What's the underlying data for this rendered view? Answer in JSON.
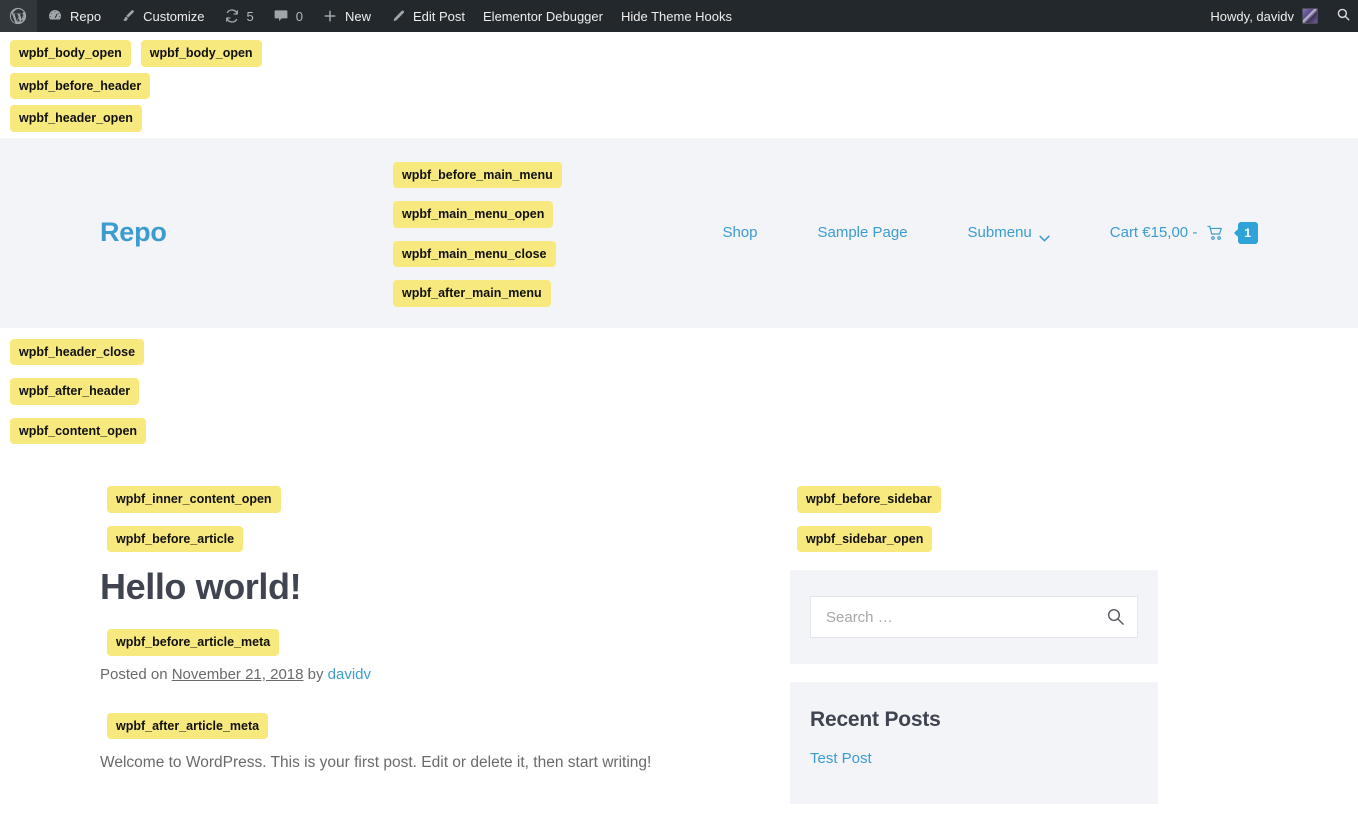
{
  "adminbar": {
    "logo_icon": "wordpress-logo-icon",
    "items": [
      {
        "icon": "dashboard-icon",
        "label": "Repo"
      },
      {
        "icon": "brush-icon",
        "label": "Customize"
      },
      {
        "icon": "refresh-icon",
        "label": "5"
      },
      {
        "icon": "comment-icon",
        "label": "0"
      },
      {
        "icon": "plus-icon",
        "label": "New"
      },
      {
        "icon": "pencil-icon",
        "label": "Edit Post"
      },
      {
        "icon": "",
        "label": "Elementor Debugger"
      },
      {
        "icon": "",
        "label": "Hide Theme Hooks"
      }
    ],
    "howdy": "Howdy, davidv",
    "avatar_name": "user-avatar",
    "search_icon": "search-icon"
  },
  "hooks": {
    "body_open_1": "wpbf_body_open",
    "body_open_2": "wpbf_body_open",
    "before_header": "wpbf_before_header",
    "header_open": "wpbf_header_open",
    "before_main_menu": "wpbf_before_main_menu",
    "main_menu_open": "wpbf_main_menu_open",
    "main_menu_close": "wpbf_main_menu_close",
    "after_main_menu": "wpbf_after_main_menu",
    "header_close": "wpbf_header_close",
    "after_header": "wpbf_after_header",
    "content_open": "wpbf_content_open",
    "inner_content_open": "wpbf_inner_content_open",
    "before_article": "wpbf_before_article",
    "before_article_meta": "wpbf_before_article_meta",
    "after_article_meta": "wpbf_after_article_meta",
    "before_sidebar": "wpbf_before_sidebar",
    "sidebar_open": "wpbf_sidebar_open"
  },
  "header": {
    "logo": "Repo",
    "nav": [
      {
        "label": "Shop",
        "has_chevron": false
      },
      {
        "label": "Sample Page",
        "has_chevron": false
      },
      {
        "label": "Submenu",
        "has_chevron": true
      }
    ],
    "cart": {
      "label": "Cart €15,00 -",
      "icon": "cart-icon",
      "count": "1"
    }
  },
  "post": {
    "title": "Hello world!",
    "meta_prefix": "Posted on ",
    "date": "November 21, 2018",
    "meta_by": " by ",
    "author": "davidv",
    "body": "Welcome to WordPress. This is your first post. Edit or delete it, then start writing!"
  },
  "sidebar": {
    "search": {
      "placeholder": "Search …",
      "value": "",
      "submit_icon": "search-icon"
    },
    "recent_posts": {
      "title": "Recent Posts",
      "items": [
        {
          "label": "Test Post"
        }
      ]
    }
  },
  "colors": {
    "admin_bar_bg": "#23282d",
    "hook_badge_bg": "#f8e97f",
    "header_bg": "#f2f4f7",
    "link_blue": "#3c9cd0",
    "cart_badge": "#2fa3d8",
    "heading": "#3f4450",
    "body_text": "#6a6a6a"
  }
}
